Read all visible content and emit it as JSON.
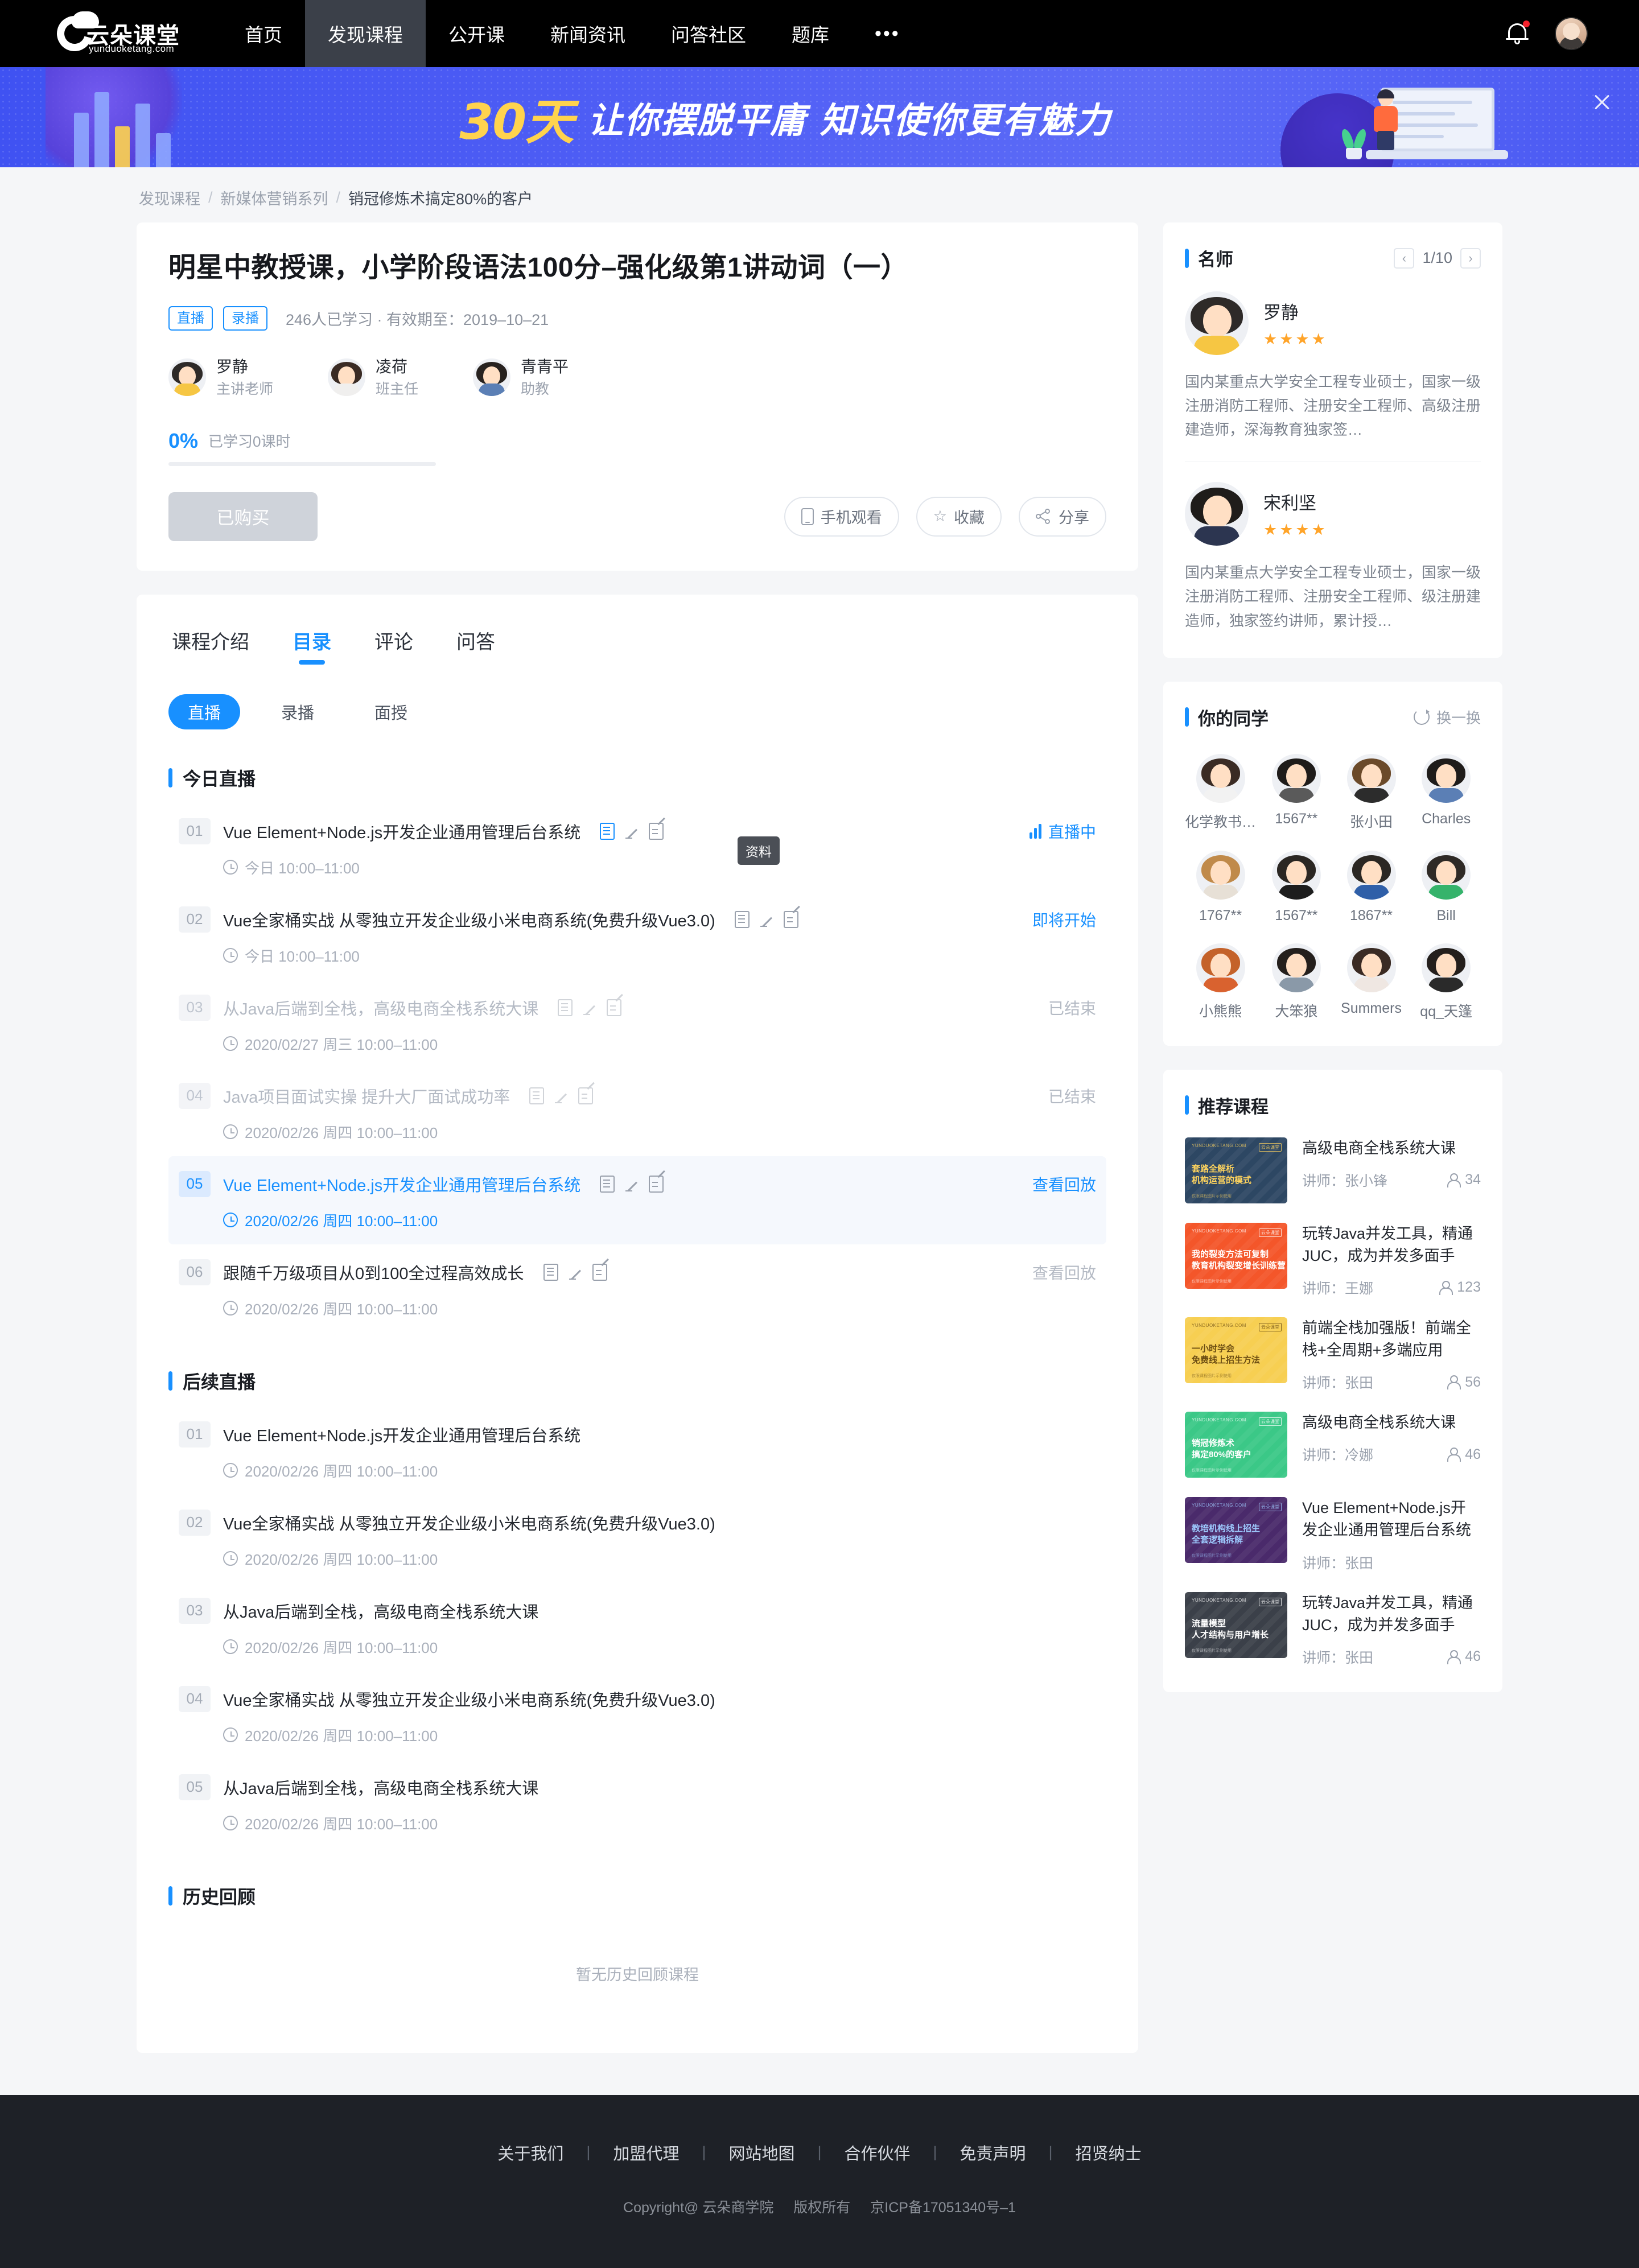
{
  "nav": {
    "logo_cn": "云朵课堂",
    "logo_en": "yunduoketang.com",
    "items": [
      {
        "label": "首页",
        "active": false
      },
      {
        "label": "发现课程",
        "active": true
      },
      {
        "label": "公开课",
        "active": false
      },
      {
        "label": "新闻资讯",
        "active": false
      },
      {
        "label": "问答社区",
        "active": false
      },
      {
        "label": "题库",
        "active": false
      }
    ],
    "more": "•••"
  },
  "banner": {
    "highlight": "30天",
    "text": "让你摆脱平庸  知识使你更有魅力",
    "close_icon": "close-icon"
  },
  "breadcrumb": [
    "发现课程",
    "新媒体营销系列",
    "销冠修炼术搞定80%的客户"
  ],
  "course": {
    "title": "明星中教授课，小学阶段语法100分–强化级第1讲动词（一）",
    "tags": [
      "直播",
      "录播"
    ],
    "meta": "246人已学习 · 有效期至：2019–10–21",
    "teachers": [
      {
        "name": "罗静",
        "role": "主讲老师"
      },
      {
        "name": "凌荷",
        "role": "班主任"
      },
      {
        "name": "青青平",
        "role": "助教"
      }
    ],
    "progress_pct": "0%",
    "progress_label": "已学习0课时",
    "progress_value": 0,
    "buy_button": "已购买",
    "actions": [
      {
        "label": "手机观看",
        "icon": "phone-icon"
      },
      {
        "label": "收藏",
        "icon": "star-icon"
      },
      {
        "label": "分享",
        "icon": "share-icon"
      }
    ]
  },
  "tabs": [
    {
      "label": "课程介绍",
      "active": false
    },
    {
      "label": "目录",
      "active": true
    },
    {
      "label": "评论",
      "active": false
    },
    {
      "label": "问答",
      "active": false
    }
  ],
  "subtabs": [
    {
      "label": "直播",
      "active": true
    },
    {
      "label": "录播",
      "active": false
    },
    {
      "label": "面授",
      "active": false
    }
  ],
  "tooltip": "资料",
  "sections": [
    {
      "title": "今日直播",
      "lessons": [
        {
          "num": "01",
          "title": "Vue Element+Node.js开发企业通用管理后台系统",
          "time": "今日 10:00–11:00",
          "status": "直播中",
          "status_type": "live",
          "state": "active",
          "icons": [
            "doc-icon",
            "pen-icon",
            "note-icon"
          ]
        },
        {
          "num": "02",
          "title": "Vue全家桶实战 从零独立开发企业级小米电商系统(免费升级Vue3.0)",
          "time": "今日 10:00–11:00",
          "status": "即将开始",
          "status_type": "soon",
          "state": "upcoming",
          "icons": [
            "doc-icon",
            "pen-icon",
            "note-icon"
          ]
        },
        {
          "num": "03",
          "title": "从Java后端到全栈，高级电商全栈系统大课",
          "time": "2020/02/27 周三 10:00–11:00",
          "status": "已结束",
          "status_type": "ended",
          "state": "done",
          "icons": [
            "doc-icon",
            "pen-icon",
            "note-icon"
          ]
        },
        {
          "num": "04",
          "title": "Java项目面试实操 提升大厂面试成功率",
          "time": "2020/02/26 周四 10:00–11:00",
          "status": "已结束",
          "status_type": "ended",
          "state": "done",
          "icons": [
            "doc-icon",
            "pen-icon",
            "note-icon"
          ]
        },
        {
          "num": "05",
          "title": "Vue Element+Node.js开发企业通用管理后台系统",
          "time": "2020/02/26 周四 10:00–11:00",
          "status": "查看回放",
          "status_type": "replay",
          "state": "highlight",
          "icons": [
            "doc-icon",
            "pen-icon",
            "note-icon"
          ]
        },
        {
          "num": "06",
          "title": "跟随千万级项目从0到100全过程高效成长",
          "time": "2020/02/26 周四 10:00–11:00",
          "status": "查看回放",
          "status_type": "replay-dim",
          "state": "plain",
          "icons": [
            "doc-icon",
            "pen-icon",
            "note-icon"
          ]
        }
      ]
    },
    {
      "title": "后续直播",
      "lessons": [
        {
          "num": "01",
          "title": "Vue Element+Node.js开发企业通用管理后台系统",
          "time": "2020/02/26 周四 10:00–11:00",
          "status": "",
          "status_type": "none",
          "state": "plain",
          "icons": []
        },
        {
          "num": "02",
          "title": "Vue全家桶实战 从零独立开发企业级小米电商系统(免费升级Vue3.0)",
          "time": "2020/02/26 周四 10:00–11:00",
          "status": "",
          "status_type": "none",
          "state": "plain",
          "icons": []
        },
        {
          "num": "03",
          "title": "从Java后端到全栈，高级电商全栈系统大课",
          "time": "2020/02/26 周四 10:00–11:00",
          "status": "",
          "status_type": "none",
          "state": "plain",
          "icons": []
        },
        {
          "num": "04",
          "title": "Vue全家桶实战 从零独立开发企业级小米电商系统(免费升级Vue3.0)",
          "time": "2020/02/26 周四 10:00–11:00",
          "status": "",
          "status_type": "none",
          "state": "plain",
          "icons": []
        },
        {
          "num": "05",
          "title": "从Java后端到全栈，高级电商全栈系统大课",
          "time": "2020/02/26 周四 10:00–11:00",
          "status": "",
          "status_type": "none",
          "state": "plain",
          "icons": []
        }
      ]
    }
  ],
  "history": {
    "title": "历史回顾",
    "empty": "暂无历史回顾课程"
  },
  "sidebar": {
    "teachers_panel": {
      "title": "名师",
      "pager": "1/10",
      "prev_icon": "chevron-left-icon",
      "next_icon": "chevron-right-icon",
      "items": [
        {
          "name": "罗静",
          "stars": "★★★★",
          "desc": "国内某重点大学安全工程专业硕士，国家一级注册消防工程师、注册安全工程师、高级注册建造师，深海教育独家签…"
        },
        {
          "name": "宋利坚",
          "stars": "★★★★",
          "desc": "国内某重点大学安全工程专业硕士，国家一级注册消防工程师、注册安全工程师、级注册建造师，独家签约讲师，累计授…"
        }
      ]
    },
    "classmates_panel": {
      "title": "你的同学",
      "refresh_label": "换一换",
      "refresh_icon": "refresh-icon",
      "items": [
        {
          "name": "化学教书…"
        },
        {
          "name": "1567**"
        },
        {
          "name": "张小田"
        },
        {
          "name": "Charles"
        },
        {
          "name": "1767**"
        },
        {
          "name": "1567**"
        },
        {
          "name": "1867**"
        },
        {
          "name": "Bill"
        },
        {
          "name": "小熊熊"
        },
        {
          "name": "大笨狼"
        },
        {
          "name": "Summers"
        },
        {
          "name": "qq_天篷"
        }
      ]
    },
    "recommend_panel": {
      "title": "推荐课程",
      "teacher_prefix": "讲师：",
      "items": [
        {
          "title": "高级电商全栈系统大课",
          "teacher": "张小锋",
          "count": "34",
          "thumb_color": "#2d4763",
          "thumb_text_color": "#ffd45e",
          "t1": "套路全解析",
          "t2": "机构运营的模式",
          "brand": "YUNDUOKETANG.COM",
          "badge": "云朵课堂",
          "foot": "仅限课程图片示例使用"
        },
        {
          "title": "玩转Java并发工具，精通JUC，成为并发多面手",
          "teacher": "王娜",
          "count": "123",
          "thumb_color": "#f4562a",
          "thumb_text_color": "#ffffff",
          "t1": "我的裂变方法可复制",
          "t2": "教育机构裂变增长训练营",
          "brand": "YUNDUOKETANG.COM",
          "badge": "云朵课堂",
          "foot": "仅限课程图片示例使用"
        },
        {
          "title": "前端全栈加强版！前端全栈+全周期+多端应用",
          "teacher": "张田",
          "count": "56",
          "thumb_color": "#f7cf52",
          "thumb_text_color": "#6b4c12",
          "t1": "一小时学会",
          "t2": "免费线上招生方法",
          "brand": "YUNDUOKETANG.COM",
          "badge": "云朵课堂",
          "foot": "仅限课程图片示例使用"
        },
        {
          "title": "高级电商全栈系统大课",
          "teacher": "冷娜",
          "count": "46",
          "thumb_color": "#3bc887",
          "thumb_text_color": "#ffffff",
          "t1": "销冠修炼术",
          "t2": "搞定80%的客户",
          "brand": "YUNDUOKETANG.COM",
          "badge": "云朵课堂",
          "foot": "仅限课程图片示例使用"
        },
        {
          "title": "Vue Element+Node.js开发企业通用管理后台系统",
          "teacher": "张田",
          "count": "",
          "thumb_color": "#4a2a6b",
          "thumb_text_color": "#9ecbff",
          "t1": "教培机构线上招生",
          "t2": "全套逻辑拆解",
          "brand": "YUNDUOKETANG.COM",
          "badge": "云朵课堂",
          "foot": "仅限课程图片示例使用"
        },
        {
          "title": "玩转Java并发工具，精通JUC，成为并发多面手",
          "teacher": "张田",
          "count": "46",
          "thumb_color": "#3b4049",
          "thumb_text_color": "#ffffff",
          "t1": "流量模型",
          "t2": "人才结构与用户增长",
          "brand": "YUNDUOKETANG.COM",
          "badge": "云朵课堂",
          "foot": "仅限课程图片示例使用"
        }
      ]
    }
  },
  "footer": {
    "links": [
      "关于我们",
      "加盟代理",
      "网站地图",
      "合作伙伴",
      "免责声明",
      "招贤纳士"
    ],
    "copyright": "Copyright@ 云朵商学院",
    "rights": "版权所有",
    "icp": "京ICP备17051340号–1"
  },
  "colors": {
    "accent": "#1890ff",
    "banner_bg": "#4a59f3",
    "nav_bg": "#000000",
    "footer_bg": "#1e2127",
    "star": "#ffa429"
  }
}
